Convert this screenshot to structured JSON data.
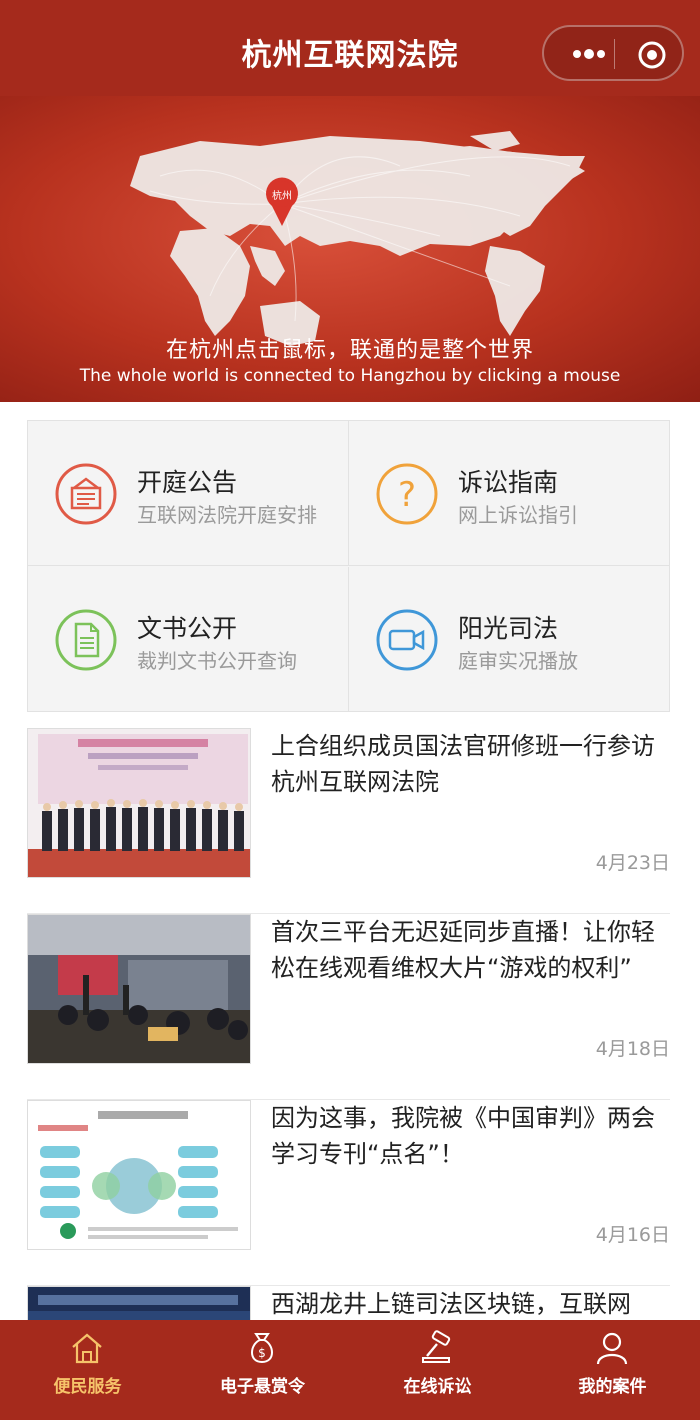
{
  "header": {
    "title": "杭州互联网法院"
  },
  "banner": {
    "marker_label": "杭州",
    "slogan_cn": "在杭州点击鼠标，联通的是整个世界",
    "slogan_en": "The whole world is connected to Hangzhou by clicking a mouse"
  },
  "services": [
    {
      "title": "开庭公告",
      "subtitle": "互联网法院开庭安排",
      "icon": "notice-board-icon",
      "color": "#e05a46"
    },
    {
      "title": "诉讼指南",
      "subtitle": "网上诉讼指引",
      "icon": "question-icon",
      "color": "#f0a23a"
    },
    {
      "title": "文书公开",
      "subtitle": "裁判文书公开查询",
      "icon": "document-icon",
      "color": "#7cc25a"
    },
    {
      "title": "阳光司法",
      "subtitle": "庭审实况播放",
      "icon": "video-camera-icon",
      "color": "#3f97d8"
    }
  ],
  "news": [
    {
      "title": "上合组织成员国法官研修班一行参访杭州互联网法院",
      "date": "4月23日"
    },
    {
      "title": "首次三平台无迟延同步直播！让你轻松在线观看维权大片“游戏的权利”",
      "date": "4月18日"
    },
    {
      "title": "因为这事，我院被《中国审判》两会学习专刊“点名”！",
      "date": "4月16日"
    },
    {
      "title": "西湖龙井上链司法区块链，互联网",
      "date": ""
    }
  ],
  "tabbar": {
    "items": [
      {
        "label": "便民服务",
        "icon": "home-icon",
        "active": true
      },
      {
        "label": "电子悬赏令",
        "icon": "money-bag-icon",
        "active": false
      },
      {
        "label": "在线诉讼",
        "icon": "gavel-icon",
        "active": false
      },
      {
        "label": "我的案件",
        "icon": "user-icon",
        "active": false
      }
    ]
  },
  "colors": {
    "brand": "#a52a1c",
    "active_tab": "#f6c36a"
  }
}
